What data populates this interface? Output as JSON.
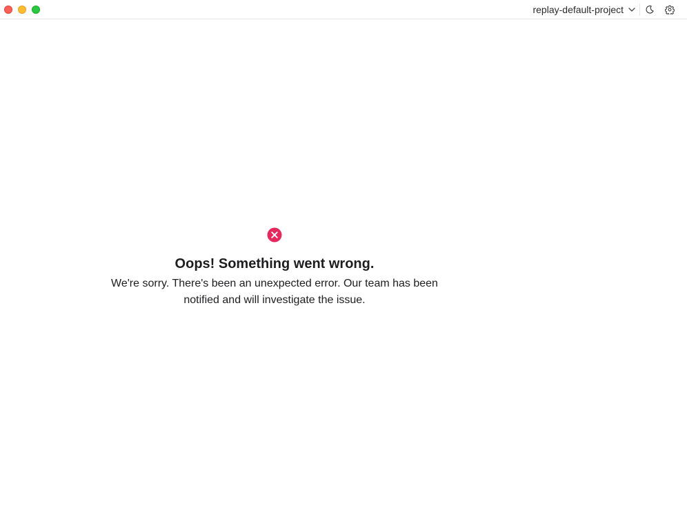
{
  "window": {
    "traffic_lights": {
      "close_color": "#fe5f57",
      "minimize_color": "#febc2e",
      "maximize_color": "#28c840"
    }
  },
  "toolbar": {
    "project_name": "replay-default-project",
    "project_dropdown_icon": "chevron-down-icon",
    "theme_icon": "moon-icon",
    "settings_icon": "gear-icon"
  },
  "error": {
    "icon": "error-circle-x-icon",
    "icon_color": "#e8285c",
    "title": "Oops! Something went wrong.",
    "message": "We're sorry. There's been an unexpected error. Our team has been notified and will investigate the issue."
  }
}
